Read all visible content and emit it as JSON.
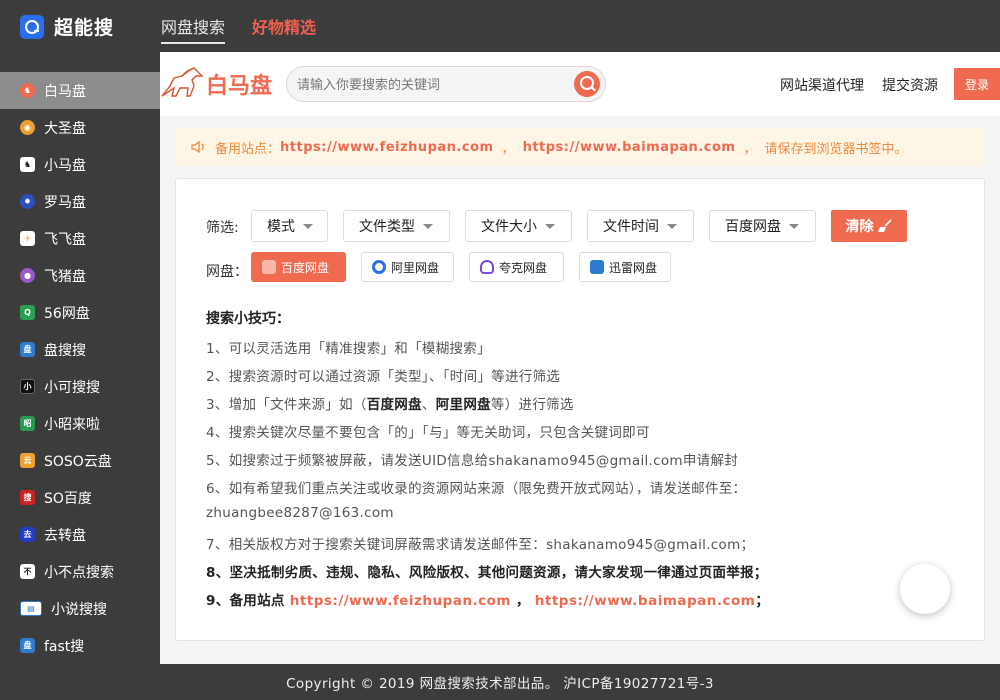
{
  "app": {
    "name": "超能搜"
  },
  "nav": {
    "tabs": [
      "网盘搜索",
      "好物精选"
    ]
  },
  "sidebar": {
    "items": [
      {
        "label": "白马盘",
        "icon": "horse-icon",
        "color": "#f06a50"
      },
      {
        "label": "大圣盘",
        "icon": "monkey-icon",
        "color": "#e8a030"
      },
      {
        "label": "小马盘",
        "icon": "pony-icon",
        "color": "#222222"
      },
      {
        "label": "罗马盘",
        "icon": "gear-icon",
        "color": "#2b50c0"
      },
      {
        "label": "飞飞盘",
        "icon": "plane-icon",
        "color": "#f0a030"
      },
      {
        "label": "飞猪盘",
        "icon": "pig-icon",
        "color": "#9a5ac8"
      },
      {
        "label": "56网盘",
        "icon": "search-icon",
        "color": "#2aa050"
      },
      {
        "label": "盘搜搜",
        "icon": "pan-icon",
        "color": "#2b7cd0"
      },
      {
        "label": "小可搜搜",
        "icon": "xiao-icon",
        "color": "#111111"
      },
      {
        "label": "小昭来啦",
        "icon": "zhao-icon",
        "color": "#2a9a50"
      },
      {
        "label": "SOSO云盘",
        "icon": "cloud-icon",
        "color": "#f0a030"
      },
      {
        "label": "SO百度",
        "icon": "sou-icon",
        "color": "#d02020"
      },
      {
        "label": "去转盘",
        "icon": "qu-icon",
        "color": "#2040c0"
      },
      {
        "label": "小不点搜索",
        "icon": "bu-icon",
        "color": "#ffffff"
      },
      {
        "label": "小说搜搜",
        "icon": "book-icon",
        "color": "#2b7cd0"
      },
      {
        "label": "fast搜",
        "icon": "fast-icon",
        "color": "#2b7cd0"
      }
    ]
  },
  "header": {
    "brand": "白马盘",
    "search_placeholder": "请输入你要搜索的关键词",
    "links": [
      "网站渠道代理",
      "提交资源"
    ],
    "login": "登录"
  },
  "notice": {
    "prefix": "备用站点：",
    "url1": "https://www.feizhupan.com",
    "comma": "，",
    "url2": "https://www.baimapan.com",
    "suffix": "请保存到浏览器书签中。"
  },
  "filters": {
    "label": "筛选:",
    "dropdowns": [
      "模式",
      "文件类型",
      "文件大小",
      "文件时间",
      "百度网盘"
    ],
    "clear": "清除"
  },
  "pans": {
    "label": "网盘：",
    "items": [
      "百度网盘",
      "阿里网盘",
      "夸克网盘",
      "迅雷网盘"
    ]
  },
  "tips": {
    "title": "搜索小技巧：",
    "t1": "1、可以灵活选用「精准搜索」和「模糊搜索」",
    "t2": "2、搜索资源时可以通过资源「类型」、「时间」等进行筛选",
    "t3a": "3、增加「文件来源」如（",
    "t3b": "百度网盘",
    "t3c": "、",
    "t3d": "阿里网盘",
    "t3e": "等）进行筛选",
    "t4": "4、搜索关键次尽量不要包含「的」「与」等无关助词，只包含关键词即可",
    "t5": "5、如搜索过于频繁被屏蔽，请发送UID信息给shakanamo945@gmail.com申请解封",
    "t6a": "6、如有希望我们重点关注或收录的资源网站来源（限免费开放式网站），请发送邮件至：",
    "t6b": "zhuangbee8287@163.com",
    "t7": "7、相关版权方对于搜索关键词屏蔽需求请发送邮件至：shakanamo945@gmail.com；",
    "t8": "8、坚决抵制劣质、违规、隐私、风险版权、其他问题资源，请大家发现一律通过页面举报；",
    "t9a": "9、备用站点",
    "t9url1": "https://www.feizhupan.com",
    "t9comma": "，",
    "t9url2": "https://www.baimapan.com",
    "t9end": "；"
  },
  "footer": {
    "text": "Copyright © 2019 网盘搜索技术部出品。 沪ICP备19027721号-3"
  },
  "colors": {
    "accent": "#f06a50",
    "dark": "#3c3c3c",
    "notice_bg": "#fdf5e6"
  }
}
